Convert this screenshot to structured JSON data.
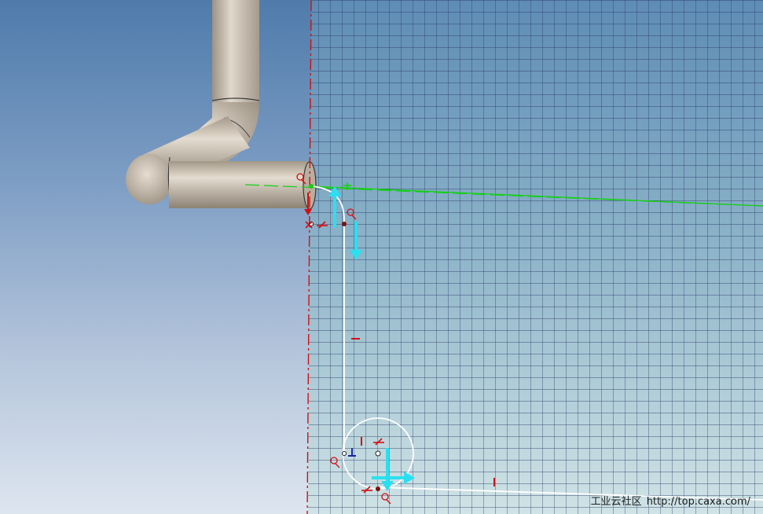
{
  "app": {
    "name": "CAXA 3D sketch viewport"
  },
  "scene": {
    "background_top": "#4f7bab",
    "background_bottom": "#dde5ef",
    "grid_color": "#2a3a6a",
    "sketch_plane_tint": "#7ba6c6",
    "pipe_color": "#c8bdb0",
    "centerline_color": "#d01010",
    "axis_green": "#13d013",
    "arrow_cyan": "#2ae0f0",
    "sketch_line_color": "#ffffff"
  },
  "icons": {
    "parallel": "parallel-constraint-icon",
    "perpendicular": "perpendicular-constraint-icon",
    "vertical": "vertical-constraint-icon",
    "horizontal": "horizontal-constraint-icon",
    "tangent": "tangent-constraint-icon",
    "coincident": "coincident-constraint-icon",
    "drag_arrow": "drag-direction-arrow-icon"
  },
  "watermark": {
    "site_name": "工业云社区",
    "url": "http://top.caxa.com/"
  }
}
